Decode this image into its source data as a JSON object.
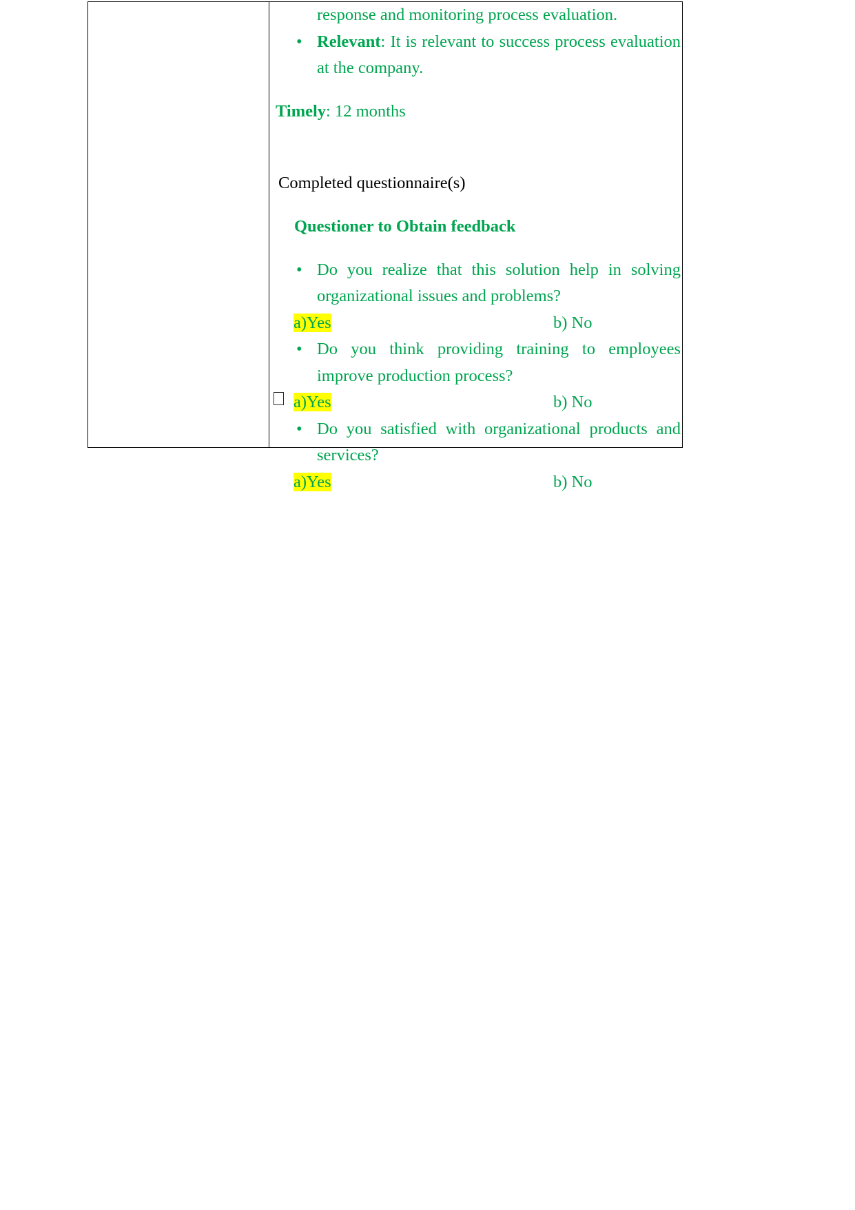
{
  "document": {
    "type": "word-processor-page",
    "page_background": "#ffffff",
    "colors": {
      "green_text": "#00A550",
      "black_text": "#000000",
      "highlight_yellow": "#FFFF00",
      "table_border": "#000000"
    }
  },
  "table": {
    "left_cell": {
      "content": ""
    },
    "right_cell": {
      "continuation_line": "response and monitoring process evaluation.",
      "smart_bullets": [
        {
          "bullet_glyph": "•",
          "label": "Relevant",
          "separator": ": ",
          "text": "It is relevant to success process evaluation at the company."
        }
      ],
      "timely": {
        "label": "Timely",
        "separator": ": ",
        "value": "12 months"
      },
      "completed_questionnaire": "Completed questionnaire(s)",
      "questioner_heading": "Questioner to Obtain feedback",
      "questions": [
        {
          "bullet_glyph": "•",
          "text": "Do you realize that this solution help in solving organizational issues and problems?",
          "option_a": "a)Yes",
          "option_b": "b) No",
          "option_a_highlighted": true
        },
        {
          "bullet_glyph": "•",
          "text": "Do you think providing training to employees improve production process?",
          "option_a": "a)Yes",
          "option_b": "b) No",
          "option_a_highlighted": true
        },
        {
          "bullet_glyph": "•",
          "text": "Do you satisfied with organizational products and services?",
          "option_a": "a)Yes",
          "option_b": "b) No",
          "option_a_highlighted": true
        }
      ],
      "trailing_checkbox": {
        "checked": false,
        "glyph": "□"
      }
    }
  }
}
